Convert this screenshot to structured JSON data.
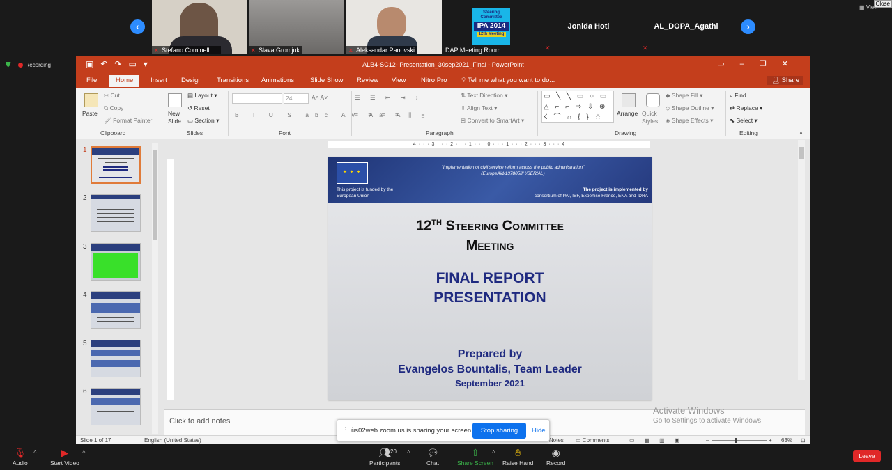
{
  "zoom": {
    "participants_strip": [
      {
        "name": "Stefano Cominelli ...",
        "type": "video"
      },
      {
        "name": "Slava Gromjuk",
        "type": "video"
      },
      {
        "name": "Aleksandar Panovski",
        "type": "video"
      },
      {
        "name": "DAP Meeting Room",
        "type": "image",
        "logo_lines": [
          "Steering",
          "Committee",
          "IPA 2014",
          "12th Meeting"
        ]
      },
      {
        "name": "Jonida Hoti",
        "type": "name"
      },
      {
        "name": "AL_DOPA_Agathi",
        "type": "name"
      }
    ],
    "view_label": "View",
    "close_label": "Close",
    "recording_label": "Recording",
    "sharing_banner": {
      "message": "us02web.zoom.us is sharing your screen.",
      "stop_label": "Stop sharing",
      "hide_label": "Hide"
    },
    "toolbar": {
      "audio": "Audio",
      "start_video": "Start Video",
      "participants": "Participants",
      "participants_count": "20",
      "chat": "Chat",
      "share_screen": "Share Screen",
      "raise_hand": "Raise Hand",
      "record": "Record",
      "leave": "Leave"
    },
    "colors": {
      "accent": "#2d8cff",
      "danger": "#e02828",
      "share_green": "#3bb54a"
    }
  },
  "powerpoint": {
    "window_title": "ALB4-SC12- Presentation_30sep2021_Final - PowerPoint",
    "tabs": [
      "File",
      "Home",
      "Insert",
      "Design",
      "Transitions",
      "Animations",
      "Slide Show",
      "Review",
      "View",
      "Nitro Pro"
    ],
    "active_tab": "Home",
    "tell_me": "Tell me what you want to do...",
    "share": "Share",
    "ribbon": {
      "clipboard": {
        "label": "Clipboard",
        "paste": "Paste",
        "cut": "Cut",
        "copy": "Copy",
        "format_painter": "Format Painter"
      },
      "slides": {
        "label": "Slides",
        "new_slide": "New Slide",
        "layout": "Layout",
        "reset": "Reset",
        "section": "Section"
      },
      "font": {
        "label": "Font",
        "size": "24"
      },
      "paragraph": {
        "label": "Paragraph",
        "text_direction": "Text Direction",
        "align_text": "Align Text",
        "convert_smartart": "Convert to SmartArt"
      },
      "drawing": {
        "label": "Drawing",
        "arrange": "Arrange",
        "quick_styles": "Quick Styles",
        "shape_fill": "Shape Fill",
        "shape_outline": "Shape Outline",
        "shape_effects": "Shape Effects"
      },
      "editing": {
        "label": "Editing",
        "find": "Find",
        "replace": "Replace",
        "select": "Select"
      }
    },
    "thumbnails": [
      "1",
      "2",
      "3",
      "4",
      "5",
      "6"
    ],
    "selected_slide": "1",
    "ruler_h": "4 · · · 3 · · · 2 · · · 1 · · · 0 · · · 1 · · · 2 · · · 3 · · · 4",
    "slide": {
      "header_quote": "\"Implementation of civil service reform across the public administration\" (EuropeAid/137805/IH/SER/AL)",
      "funded_by": "This project is funded by the European Union",
      "implemented_by_1": "The project is implemented by",
      "implemented_by_2": "consortium of PAI, IBF, Expertise France, ENA and IDRA",
      "title_num": "12",
      "title_sup": "TH",
      "title_line1_rest": "Steering Committee",
      "title_line2": "Meeting",
      "subtitle_line1": "FINAL REPORT",
      "subtitle_line2": "PRESENTATION",
      "prepared_by": "Prepared by",
      "author": "Evangelos Bountalis, Team Leader",
      "date": "September 2021"
    },
    "notes_placeholder": "Click to add notes",
    "activate_windows_title": "Activate Windows",
    "activate_windows_sub": "Go to Settings to activate Windows.",
    "status": {
      "slide_info": "Slide 1 of 17",
      "language": "English (United States)",
      "notes": "Notes",
      "comments": "Comments",
      "zoom": "63%"
    },
    "colors": {
      "brand": "#c43e1c",
      "slide_blue": "#1f2a80"
    }
  }
}
